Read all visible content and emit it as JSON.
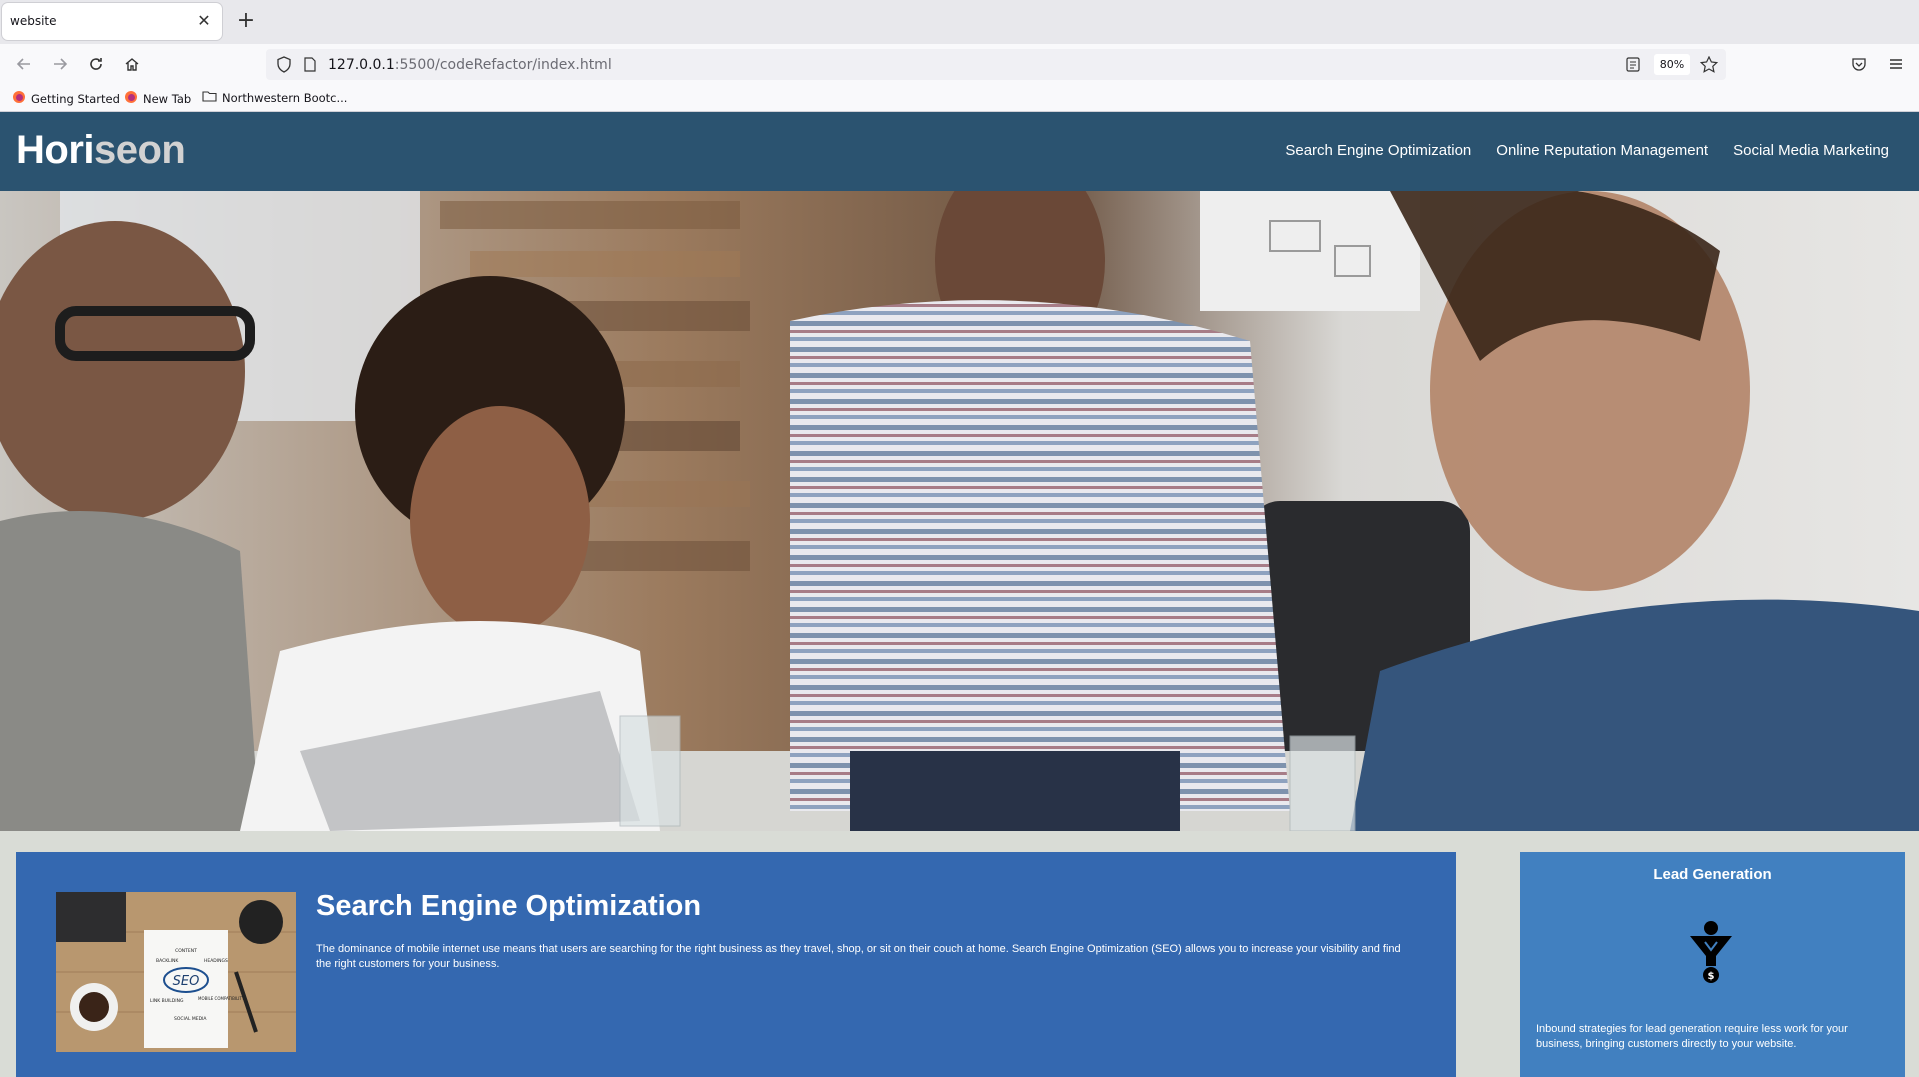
{
  "browser": {
    "tab_title": "website",
    "url_host": "127.0.0.1",
    "url_rest": ":5500/codeRefactor/index.html",
    "zoom": "80%",
    "bookmarks": [
      "Getting Started",
      "New Tab",
      "Northwestern Bootc..."
    ]
  },
  "site": {
    "logo_part1": "Hori",
    "logo_part2": "seon",
    "nav": [
      "Search Engine Optimization",
      "Online Reputation Management",
      "Social Media Marketing"
    ],
    "seo": {
      "title": "Search Engine Optimization",
      "text": "The dominance of mobile internet use means that users are searching for the right business as they travel, shop, or sit on their couch at home. Search Engine Optimization (SEO) allows you to increase your visibility and find the right customers for your business.",
      "image_words": [
        "SEO",
        "CONTENT",
        "BACKLINK",
        "HEADINGS",
        "LINK BUILDING",
        "MOBILE COMPATIBILITY",
        "SOCIAL MEDIA"
      ]
    },
    "aside": {
      "title": "Lead Generation",
      "text": "Inbound strategies for lead generation require less work for your business, bringing customers directly to your website."
    }
  }
}
